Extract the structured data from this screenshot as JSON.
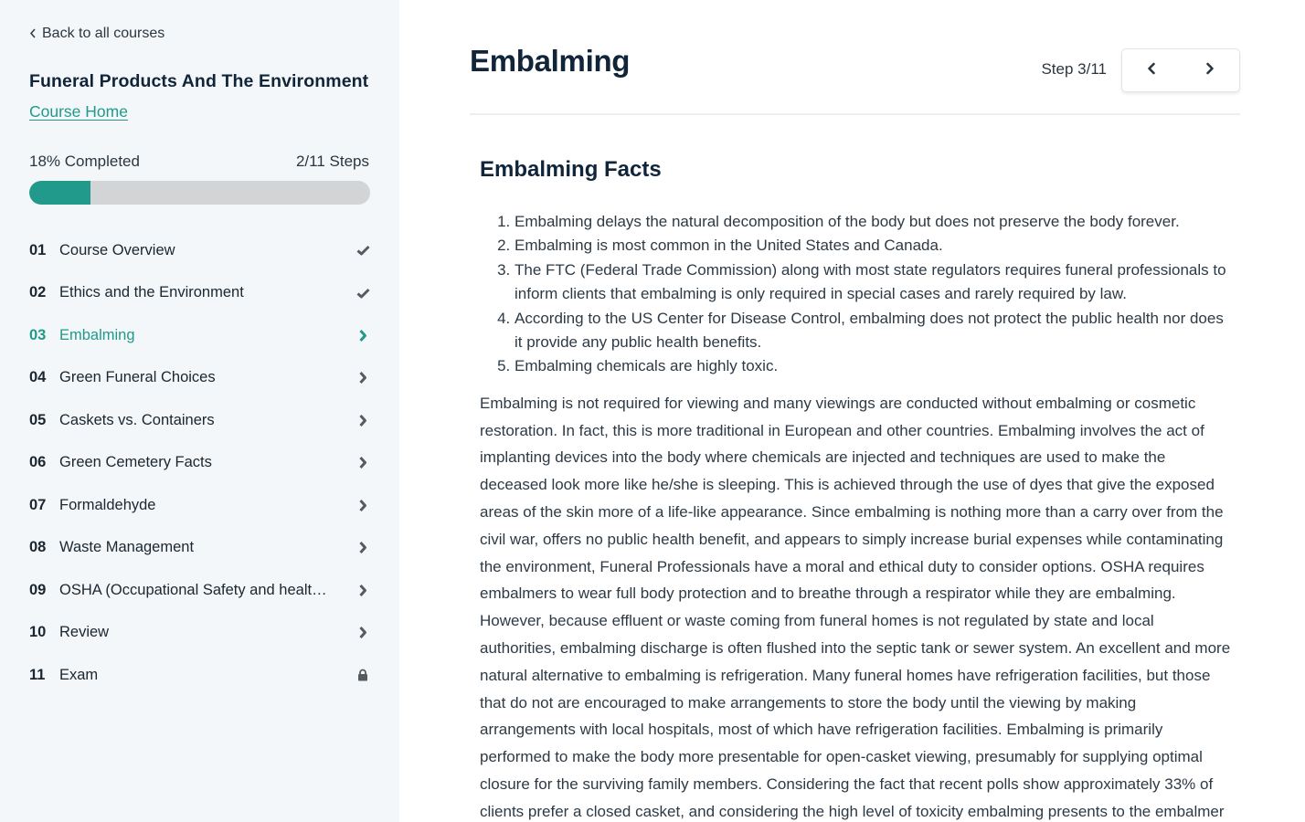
{
  "sidebar": {
    "back_label": "Back to all courses",
    "course_title": "Funeral Products And The Environment",
    "course_home_label": "Course Home",
    "progress": {
      "label": "18% Completed",
      "percent": 18,
      "steps_label": "2/11 Steps"
    },
    "steps": [
      {
        "num": "01",
        "title": "Course Overview",
        "status": "completed",
        "icon": "check-icon"
      },
      {
        "num": "02",
        "title": "Ethics and the Environment",
        "status": "completed",
        "icon": "check-icon"
      },
      {
        "num": "03",
        "title": "Embalming",
        "status": "current",
        "icon": "chevron-right-icon"
      },
      {
        "num": "04",
        "title": "Green Funeral Choices",
        "status": "available",
        "icon": "chevron-right-icon"
      },
      {
        "num": "05",
        "title": "Caskets vs. Containers",
        "status": "available",
        "icon": "chevron-right-icon"
      },
      {
        "num": "06",
        "title": "Green Cemetery Facts",
        "status": "available",
        "icon": "chevron-right-icon"
      },
      {
        "num": "07",
        "title": "Formaldehyde",
        "status": "available",
        "icon": "chevron-right-icon"
      },
      {
        "num": "08",
        "title": "Waste Management",
        "status": "available",
        "icon": "chevron-right-icon"
      },
      {
        "num": "09",
        "title": "OSHA (Occupational Safety and health ...",
        "status": "available",
        "icon": "chevron-right-icon"
      },
      {
        "num": "10",
        "title": "Review",
        "status": "available",
        "icon": "chevron-right-icon"
      },
      {
        "num": "11",
        "title": "Exam",
        "status": "locked",
        "icon": "lock-icon"
      }
    ]
  },
  "main": {
    "title": "Embalming",
    "step_counter": "Step 3/11",
    "prev_icon": "chevron-left-icon",
    "next_icon": "chevron-right-icon",
    "section_title": "Embalming Facts",
    "facts": [
      "Embalming delays the natural decomposition of the body but does not preserve the body forever.",
      "Embalming is most common in the United States and Canada.",
      "The FTC (Federal Trade Commission) along with most state regulators requires funeral professionals to inform clients that embalming is only required in special cases and rarely required by law.",
      "According to the US Center for Disease Control, embalming does not protect the public health nor does it provide any public health benefits.",
      "Embalming chemicals are highly toxic."
    ],
    "body": "Embalming is not required for viewing and many viewings are conducted without embalming or cosmetic restoration. In fact, this is more traditional in European and other countries. Embalming involves the act of implanting devices into the body where chemicals are injected and techniques are used to make the deceased look more like he/she is sleeping. This is achieved through the use of dyes that give the exposed areas of the skin more of a life-like appearance. Since embalming is nothing more than a carry over from the civil war, offers no public health benefit, and appears to simply increase burial expenses while contaminating the environment, Funeral Professionals have a moral and ethical duty to consider options. OSHA requires embalmers to wear full body protection and to breathe through a respirator while they are embalming. However, because effluent or waste coming from funeral homes is not regulated by state and local authorities, embalming discharge is often flushed into the septic tank or sewer system. An excellent and more natural alternative to embalming is refrigeration. Many funeral homes have refrigeration facilities, but those that do not are encouraged to make arrangements to store the body until the viewing by making arrangements with local hospitals, most of which have refrigeration facilities. Embalming is primarily performed to make the body more presentable for open-casket viewing, presumably for supplying optimal closure for the surviving family members. Considering the fact that recent polls show approximately 33% of clients prefer a closed casket, and considering the high level of toxicity embalming presents to the embalmer"
  },
  "colors": {
    "accent": "#1f9a8a",
    "progress_fill": "#21998b",
    "progress_track": "#d2d4d6",
    "heading": "#10243a",
    "sidebar_bg": "#f4f7f9",
    "icon_gray": "#555b60"
  }
}
